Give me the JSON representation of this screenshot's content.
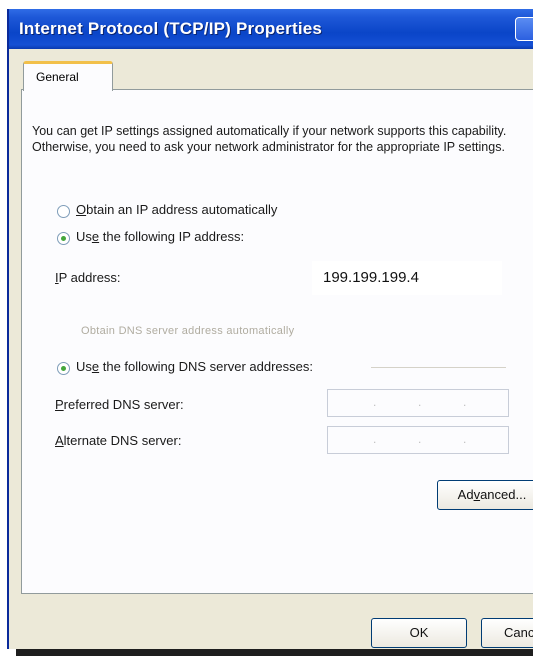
{
  "window": {
    "title": "Internet Protocol (TCP/IP) Properties"
  },
  "tabs": [
    {
      "label": "General"
    }
  ],
  "description": "You can get IP settings assigned automatically if your network supports this capability. Otherwise, you need to ask your network administrator for the appropriate IP settings.",
  "ip_section": {
    "auto_option": {
      "u": "O",
      "rest": "btain an IP address automatically",
      "checked": false
    },
    "manual_option": {
      "pre": "Us",
      "u": "e",
      "rest": " the following IP address:",
      "checked": true
    },
    "ip_label": {
      "u": "I",
      "rest": "P address:"
    },
    "ip_value": "199.199.199.4"
  },
  "dns_section": {
    "auto_option": {
      "label": "Obtain DNS server address automatically",
      "enabled": false
    },
    "manual_option": {
      "pre": "Us",
      "u": "e",
      "rest": " the following DNS server addresses:",
      "checked": true
    },
    "preferred_label": {
      "u": "P",
      "rest": "referred DNS server:"
    },
    "alternate_label": {
      "u": "A",
      "rest": "lternate DNS server:"
    },
    "preferred_value": "",
    "alternate_value": ""
  },
  "buttons": {
    "advanced": {
      "pre": "Ad",
      "u": "v",
      "rest": "anced..."
    },
    "ok": "OK",
    "cancel": "Cancel"
  },
  "colors": {
    "titlebar": "#0a45c8",
    "dialog_bg": "#ece9d8",
    "tab_highlight": "#f2c04a",
    "radio_dot": "#44a63c"
  }
}
